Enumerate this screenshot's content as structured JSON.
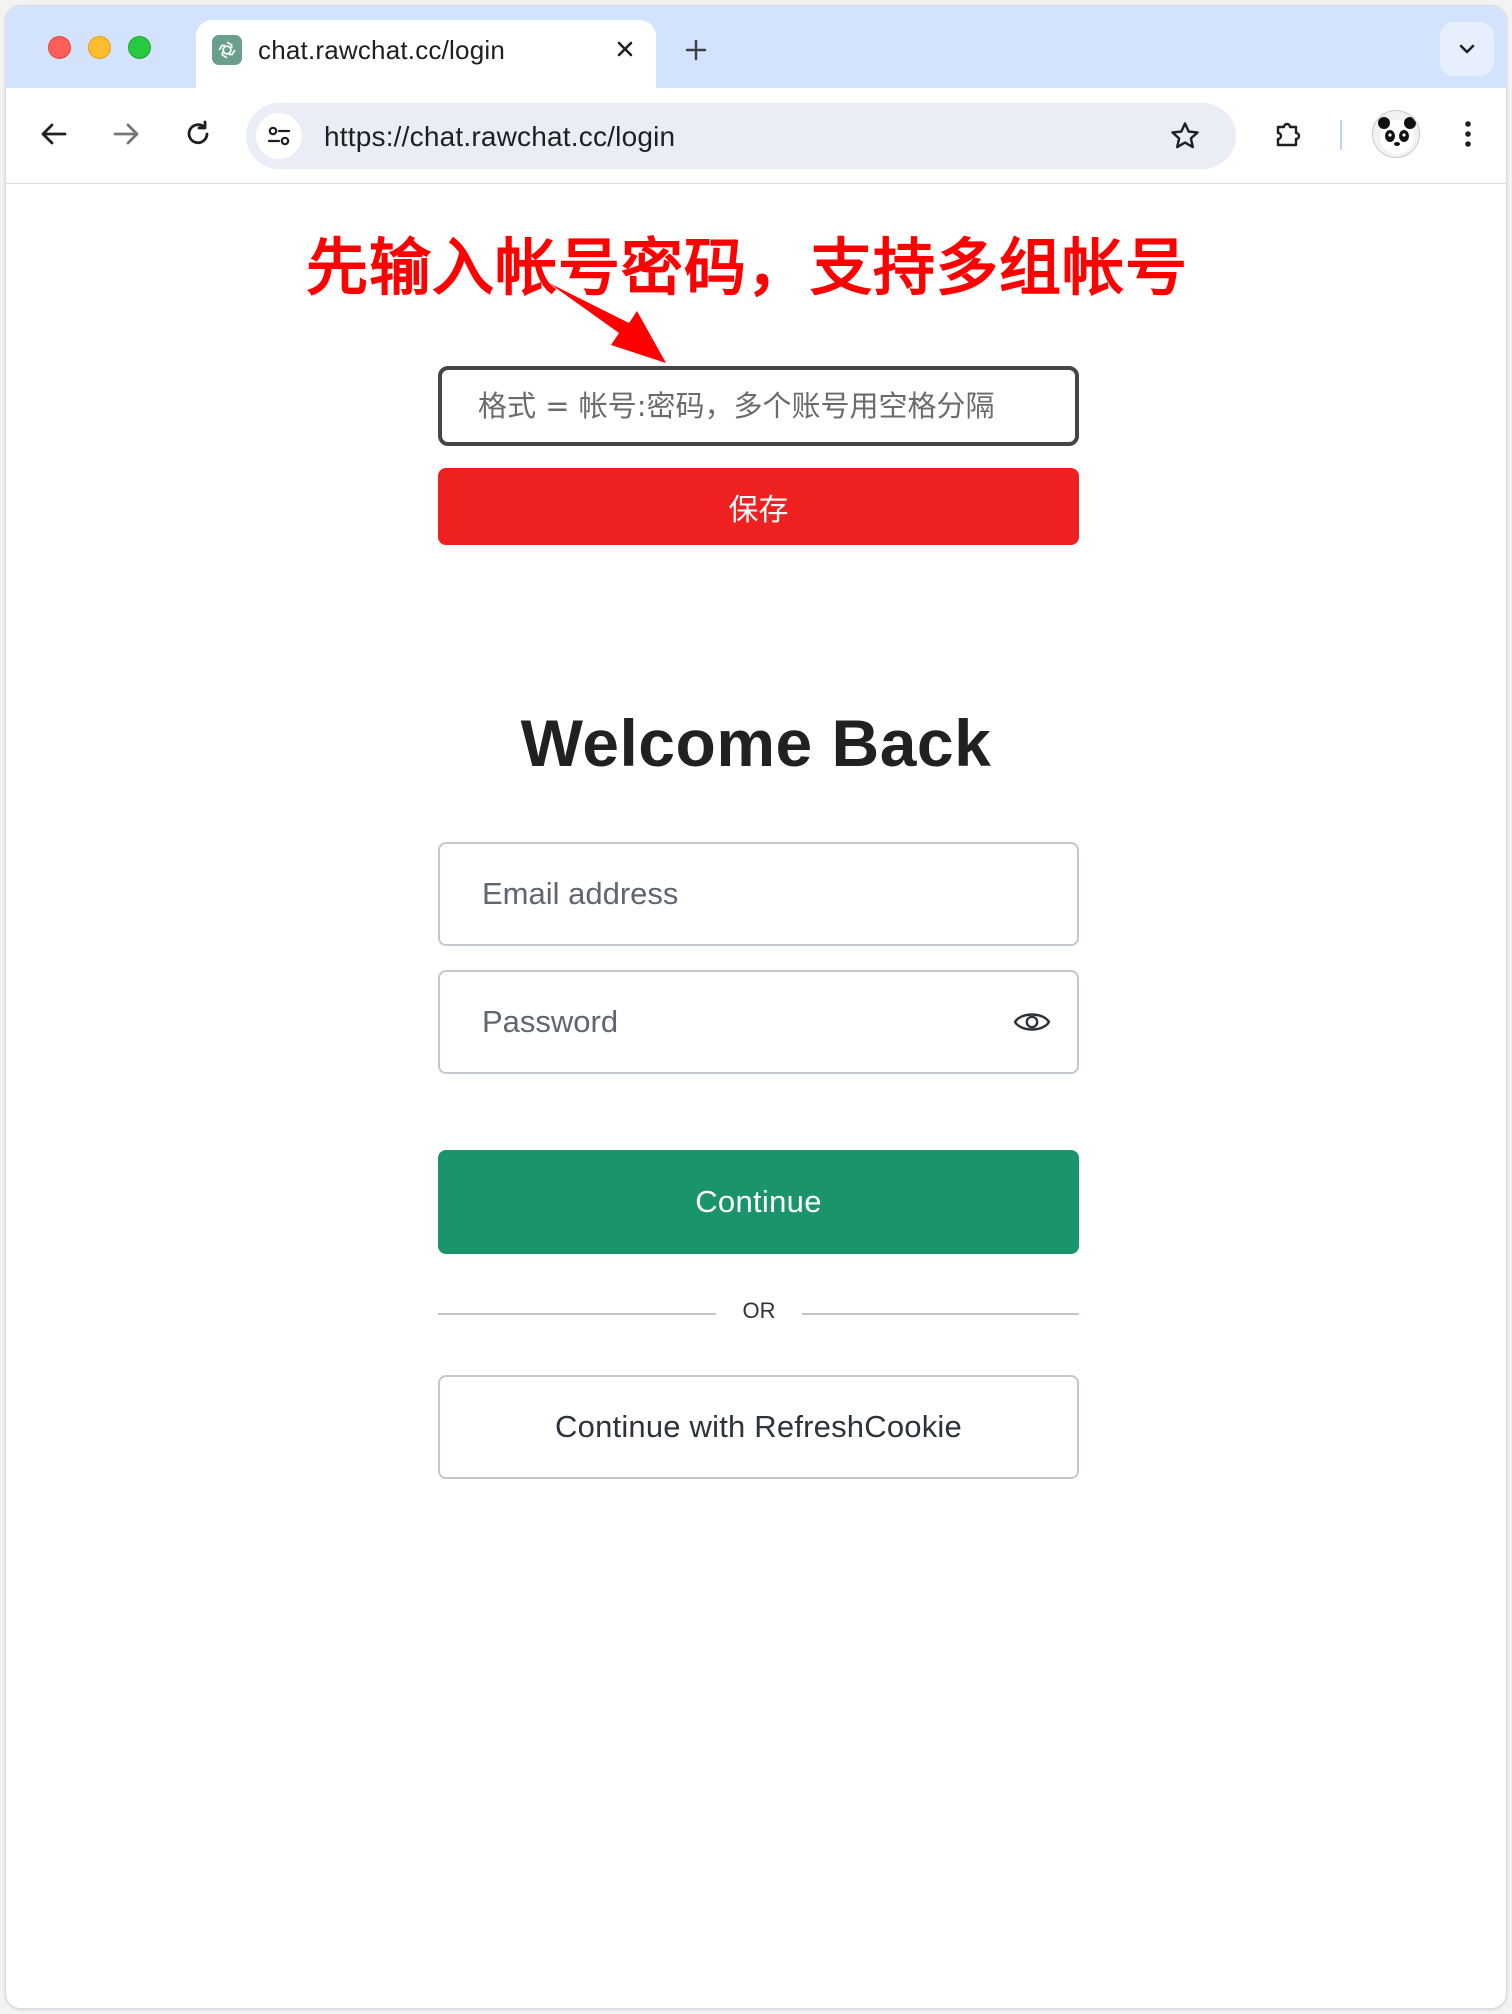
{
  "browser": {
    "tab": {
      "title": "chat.rawchat.cc/login",
      "favicon": "openai-logo-icon"
    },
    "address_bar": {
      "url": "https://chat.rawchat.cc/login"
    },
    "icons": {
      "back": "arrow-left-icon",
      "forward": "arrow-right-icon",
      "reload": "reload-icon",
      "site_info": "tune-icon",
      "bookmark": "star-icon",
      "extensions": "puzzle-icon",
      "menu": "three-dots-vertical-icon",
      "tab_search": "chevron-down-icon",
      "new_tab": "plus-icon",
      "close_tab": "close-icon",
      "profile": "panda-avatar"
    }
  },
  "annotation": {
    "text": "先输入帐号密码，支持多组帐号",
    "color": "#ff0000"
  },
  "account_form": {
    "placeholder": "格式 = 帐号:密码，多个账号用空格分隔",
    "value": "",
    "save_label": "保存",
    "save_color": "#ee2020"
  },
  "login": {
    "heading": "Welcome Back",
    "email_placeholder": "Email address",
    "password_placeholder": "Password",
    "continue_label": "Continue",
    "continue_color": "#1a946b",
    "divider_text": "OR",
    "refresh_cookie_label": "Continue with RefreshCookie"
  }
}
